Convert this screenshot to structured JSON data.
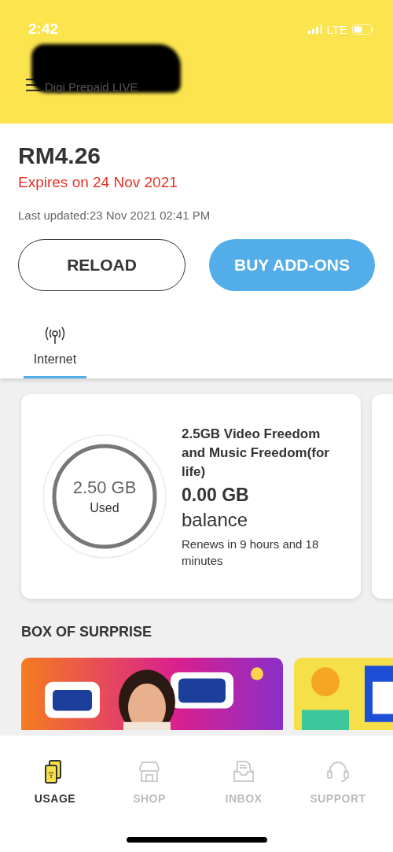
{
  "status_bar": {
    "time": "2:42",
    "network": "LTE"
  },
  "header": {
    "subtitle": "Digi Prepaid LIVE"
  },
  "balance": {
    "amount": "RM4.26",
    "expiry": "Expires on 24 Nov 2021",
    "last_updated": "Last updated:23 Nov 2021 02:41 PM"
  },
  "buttons": [
    {
      "label": "RELOAD",
      "kind": "outline"
    },
    {
      "label": "BUY ADD-ONS",
      "kind": "filled"
    }
  ],
  "tabs": [
    {
      "label": "Internet",
      "selected": true
    }
  ],
  "usage_card": {
    "ring_value": "2.50 GB",
    "ring_label": "Used",
    "plan": "2.5GB Video Freedom and Music Freedom(for life)",
    "remaining": "0.00 GB",
    "remaining_label": "balance",
    "renewal": "Renews in 9 hours and 18 minutes"
  },
  "section_title": "BOX OF SURPRISE",
  "nav": [
    {
      "label": "USAGE",
      "selected": true
    },
    {
      "label": "SHOP",
      "selected": false
    },
    {
      "label": "INBOX",
      "selected": false
    },
    {
      "label": "SUPPORT",
      "selected": false
    }
  ]
}
